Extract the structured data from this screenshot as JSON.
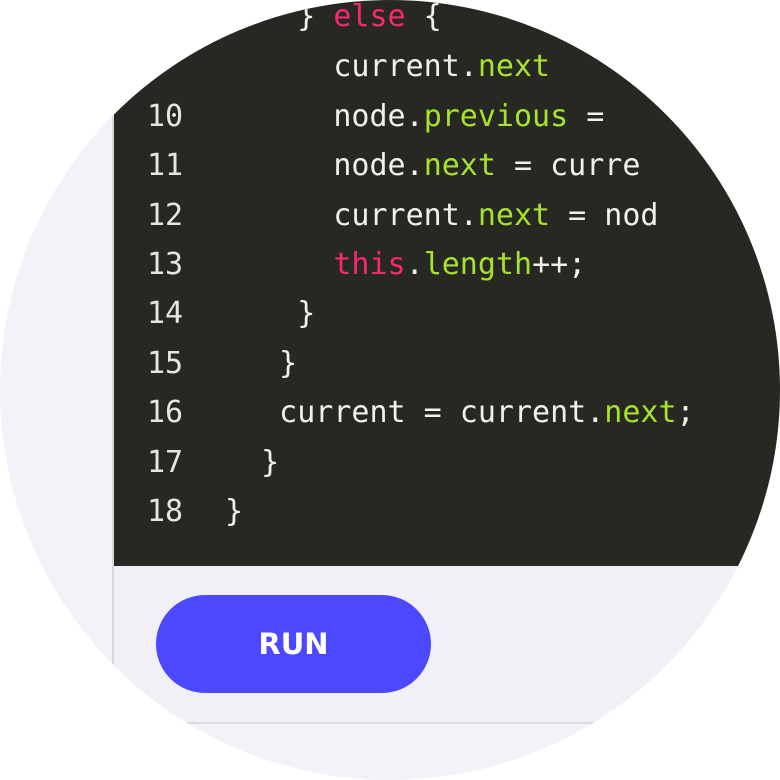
{
  "editor": {
    "lines": [
      {
        "number": "",
        "tokens": [
          {
            "t": "    ",
            "c": ""
          },
          {
            "t": "} ",
            "c": ""
          },
          {
            "t": "else",
            "c": "kw"
          },
          {
            "t": " {",
            "c": ""
          }
        ]
      },
      {
        "number": "",
        "tokens": [
          {
            "t": "      current.",
            "c": ""
          },
          {
            "t": "next",
            "c": "prop"
          }
        ]
      },
      {
        "number": "10",
        "tokens": [
          {
            "t": "      node.",
            "c": ""
          },
          {
            "t": "previous",
            "c": "prop"
          },
          {
            "t": " =",
            "c": ""
          }
        ]
      },
      {
        "number": "11",
        "tokens": [
          {
            "t": "      node.",
            "c": ""
          },
          {
            "t": "next",
            "c": "prop"
          },
          {
            "t": " = curre",
            "c": ""
          }
        ]
      },
      {
        "number": "12",
        "tokens": [
          {
            "t": "      current.",
            "c": ""
          },
          {
            "t": "next",
            "c": "prop"
          },
          {
            "t": " = nod",
            "c": ""
          }
        ]
      },
      {
        "number": "13",
        "tokens": [
          {
            "t": "      ",
            "c": ""
          },
          {
            "t": "this",
            "c": "kw"
          },
          {
            "t": ".",
            "c": ""
          },
          {
            "t": "length",
            "c": "prop"
          },
          {
            "t": "++;",
            "c": ""
          }
        ]
      },
      {
        "number": "14",
        "tokens": [
          {
            "t": "    }",
            "c": ""
          }
        ]
      },
      {
        "number": "15",
        "tokens": [
          {
            "t": "   }",
            "c": ""
          }
        ]
      },
      {
        "number": "16",
        "tokens": [
          {
            "t": "   current = current.",
            "c": ""
          },
          {
            "t": "next",
            "c": "prop"
          },
          {
            "t": ";",
            "c": ""
          }
        ]
      },
      {
        "number": "17",
        "tokens": [
          {
            "t": "  }",
            "c": ""
          }
        ]
      },
      {
        "number": "18",
        "tokens": [
          {
            "t": "}",
            "c": ""
          }
        ]
      }
    ],
    "colors": {
      "background": "#272822",
      "keyword": "#f92672",
      "property": "#a6e22e",
      "text": "#f1f1ec"
    }
  },
  "toolbar": {
    "run_label": "RUN",
    "run_color": "#4b48ff"
  }
}
